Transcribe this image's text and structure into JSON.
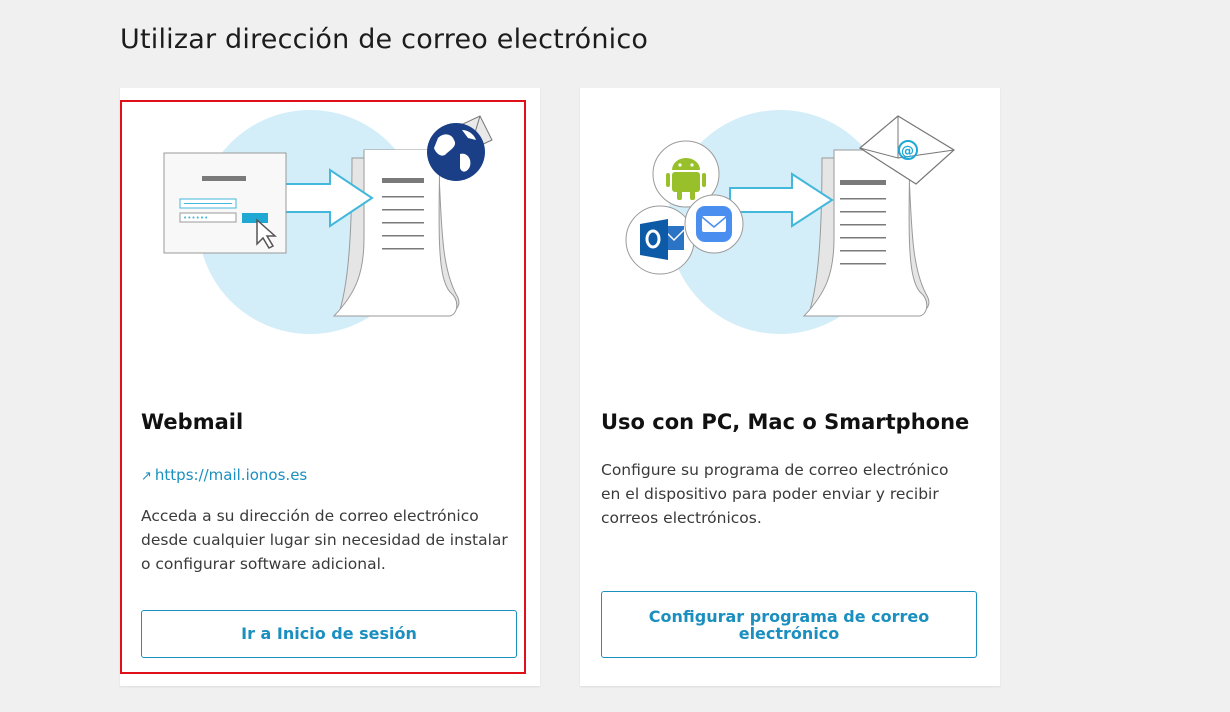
{
  "page": {
    "title": "Utilizar dirección de correo electrónico"
  },
  "colors": {
    "accent": "#1b8fbf",
    "highlight": "#e0101a",
    "circle": "#d3eef8",
    "background": "#f0f0f0"
  },
  "cards": {
    "webmail": {
      "title": "Webmail",
      "link_arrow": "↗",
      "link_text": "https://mail.ionos.es",
      "description": "Acceda a su dirección de correo electrónico desde cualquier lugar sin necesidad de instalar o configurar software adicional.",
      "button_label": "Ir a Inicio de sesión",
      "icons": [
        "login-form-illustration",
        "cursor-icon",
        "arrow-icon",
        "document-icon",
        "globe-icon",
        "envelope-icon"
      ]
    },
    "client": {
      "title": "Uso con PC, Mac o Smartphone",
      "description": "Configure su programa de correo electrónico en el dispositivo para poder enviar y recibir correos electrónicos.",
      "button_label": "Configurar programa de correo electrónico",
      "icons": [
        "android-icon",
        "outlook-icon",
        "apple-mail-icon",
        "arrow-icon",
        "document-icon",
        "envelope-at-icon"
      ]
    }
  }
}
